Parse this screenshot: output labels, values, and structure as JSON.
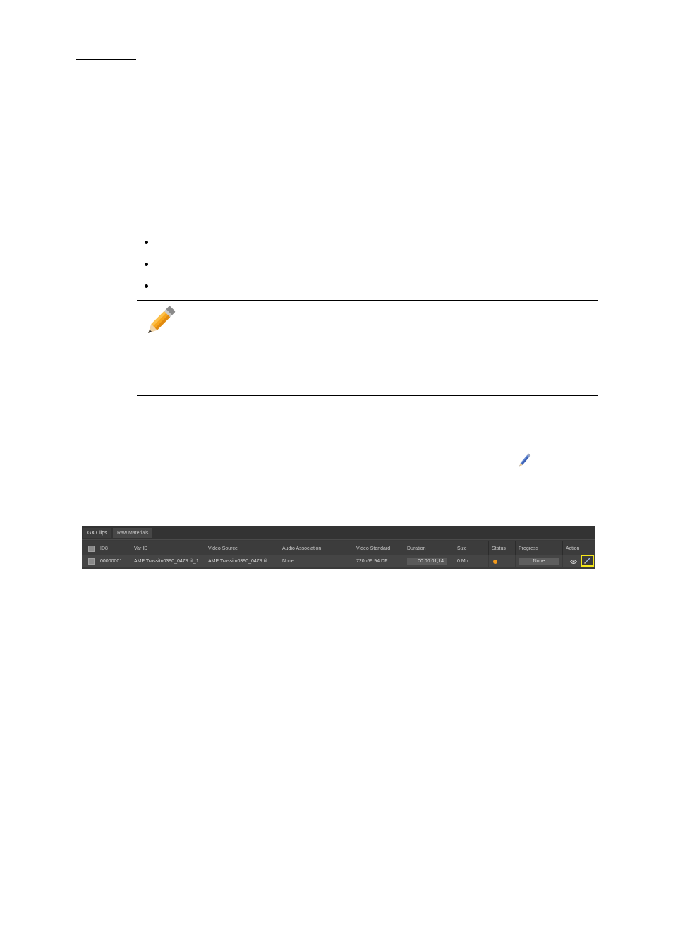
{
  "screenshot": {
    "tabs": [
      {
        "label": "GX Clips"
      },
      {
        "label": "Raw Materials"
      }
    ],
    "columns": [
      "",
      "ID8",
      "Var ID",
      "Video Source",
      "Audio Association",
      "Video Standard",
      "Duration",
      "Size",
      "Status",
      "Progress",
      "Action"
    ],
    "row": {
      "id8": "00000001",
      "var_id": "AMP Trassitn0390_0478.tif_1",
      "video_source": "AMP Trassitn0390_0478.tif",
      "audio_association": "None",
      "video_standard": "720p59.94 DF",
      "duration": "00:00:01;14.",
      "size": "0 Mb",
      "status_color": "#f39a1c",
      "progress": "None"
    },
    "highlight_color": "#f5e61a"
  },
  "icons": {
    "note": "pencil-note-icon",
    "inline": "pencil-edit-icon",
    "row_view": "eye-icon",
    "row_edit": "edit-icon"
  }
}
